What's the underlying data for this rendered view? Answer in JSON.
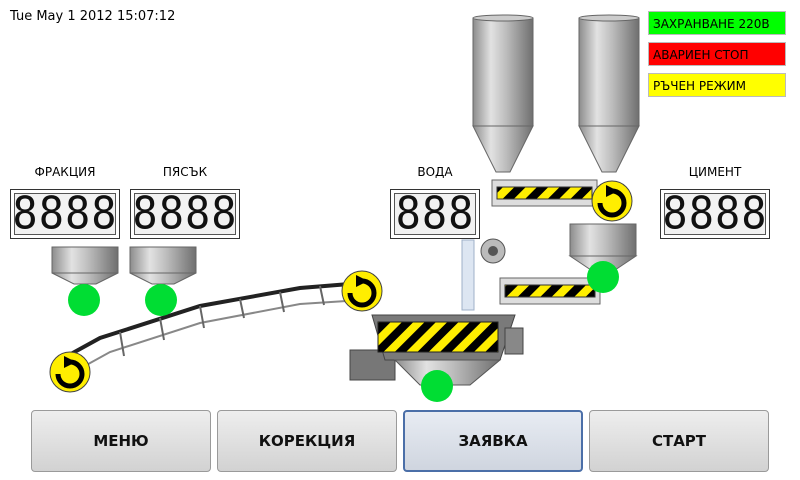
{
  "header": {
    "datetime": "Tue May 1 2012  15:07:12"
  },
  "status": {
    "saving": {
      "label": "ЗАХРАНВАНЕ 220В",
      "color": "#00ff00"
    },
    "emergency": {
      "label": "АВАРИЕН СТОП",
      "color": "#ff0000"
    },
    "manual": {
      "label": "РЪЧЕН РЕЖИМ",
      "color": "#ffff00"
    }
  },
  "gauges": {
    "fraction": {
      "label": "ФРАКЦИЯ",
      "value": "8888"
    },
    "sand": {
      "label": "ПЯСЪК",
      "value": "8888"
    },
    "water": {
      "label": "ВОДА",
      "value": "888"
    },
    "cement": {
      "label": "ЦИМЕНТ",
      "value": "8888"
    }
  },
  "buttons": {
    "menu": "МЕНЮ",
    "correction": "КОРЕКЦИЯ",
    "order": "ЗАЯВКА",
    "start": "СТАРТ"
  },
  "colors": {
    "indicator_on": "#00dd33",
    "hazard_yellow": "#ffee00",
    "hazard_black": "#000000"
  }
}
